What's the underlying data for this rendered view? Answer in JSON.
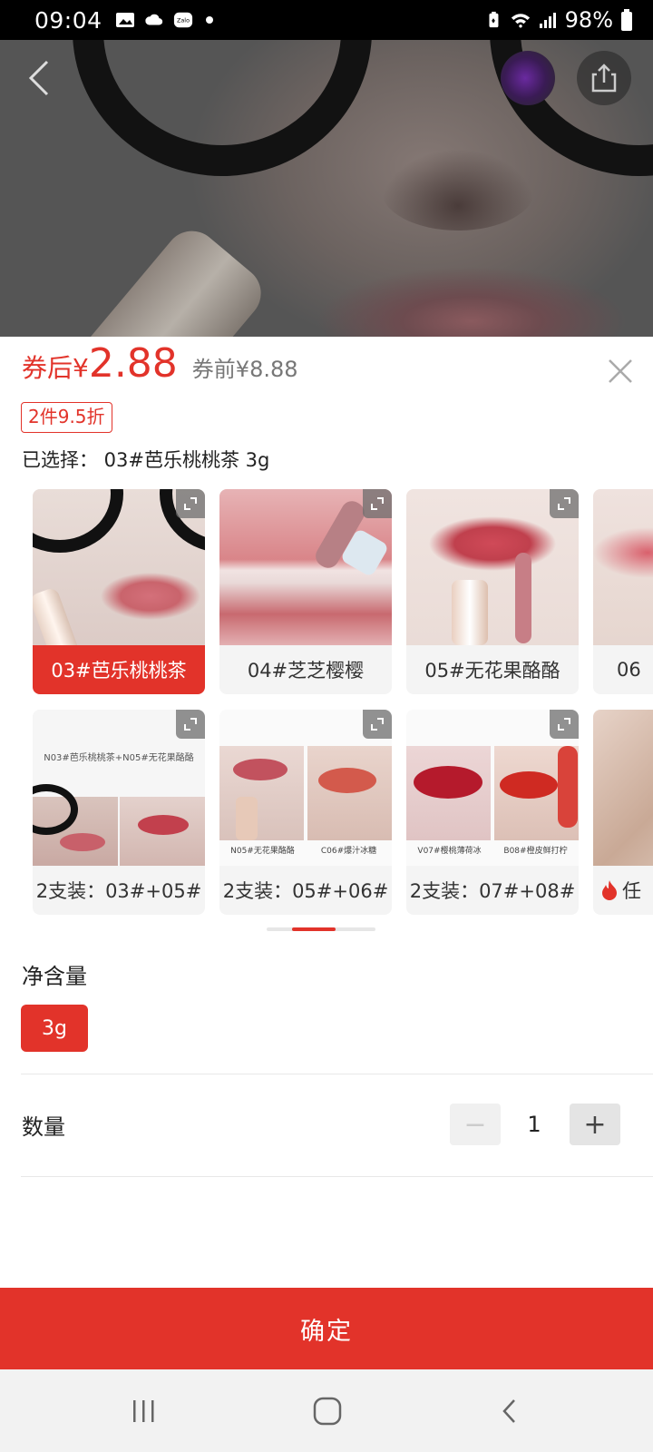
{
  "status_bar": {
    "time": "09:04",
    "battery": "98%",
    "left_icons": [
      "image-icon",
      "cloud-icon",
      "zalo-icon",
      "dot-icon"
    ],
    "right_icons": [
      "battery-saver-icon",
      "wifi-icon",
      "signal-icon",
      "battery-icon"
    ]
  },
  "header": {
    "back_icon": "chevron-left-icon",
    "share_icon": "share-icon"
  },
  "price": {
    "prefix": "券后¥",
    "value": "2.88",
    "before": "券前¥8.88",
    "promo": "2件9.5折"
  },
  "selection": {
    "text": "已选择： 03#芭乐桃桃茶 3g"
  },
  "variants": [
    {
      "label": "03#芭乐桃桃茶",
      "selected": true
    },
    {
      "label": "04#芝芝樱樱",
      "selected": false
    },
    {
      "label": "05#无花果酪酪",
      "selected": false
    },
    {
      "label": "06",
      "selected": false
    },
    {
      "label": "2支装：03#+05#",
      "selected": false,
      "caption": "N03#芭乐桃桃茶+N05#无花果酪酪"
    },
    {
      "label": "2支装：05#+06#",
      "selected": false,
      "caption_left": "N05#无花果酪酪",
      "caption_right": "C06#爆汁冰糖"
    },
    {
      "label": "2支装：07#+08#",
      "selected": false,
      "caption_left": "V07#樱桃薄荷冰",
      "caption_right": "B08#橙皮鲜打柠"
    },
    {
      "label": "任",
      "selected": false
    }
  ],
  "net_content": {
    "title": "净含量",
    "option": "3g"
  },
  "quantity": {
    "title": "数量",
    "value": "1",
    "minus": "−",
    "plus": "+"
  },
  "confirm_label": "确定",
  "colors": {
    "accent": "#e2332a"
  }
}
